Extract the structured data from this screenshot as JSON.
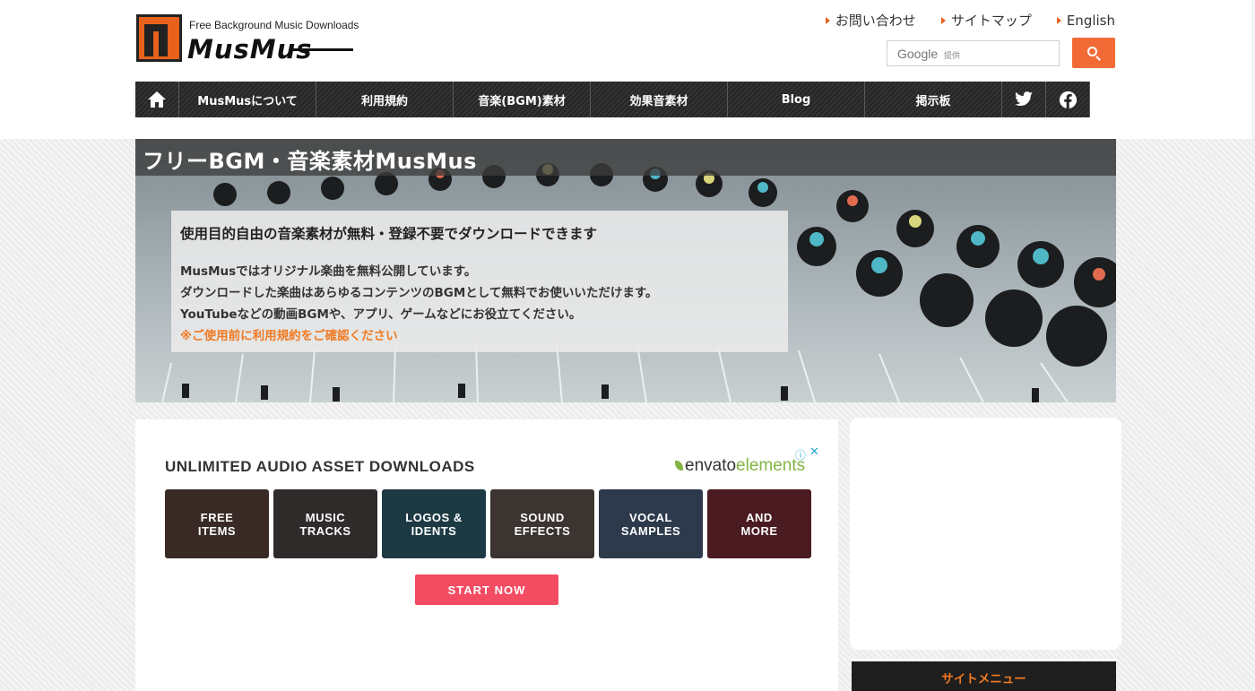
{
  "header": {
    "logo": {
      "tagline": "Free Background Music Downloads",
      "wordmark": "MusMus"
    },
    "top_links": [
      {
        "label": "お問い合わせ"
      },
      {
        "label": "サイトマップ"
      },
      {
        "label": "English"
      }
    ],
    "search": {
      "logo_text": "Google",
      "provided_label": "提供",
      "button_icon": "search-icon"
    }
  },
  "nav": {
    "home_icon": "home-icon",
    "items": [
      {
        "label": "MusMusについて"
      },
      {
        "label": "利用規約"
      },
      {
        "label": "音楽(BGM)素材"
      },
      {
        "label": "効果音素材"
      },
      {
        "label": "Blog"
      },
      {
        "label": "掲示板"
      }
    ],
    "social_icons": [
      "twitter-icon",
      "facebook-icon"
    ]
  },
  "hero": {
    "title": "フリーBGM・音楽素材MusMus",
    "intro_heading": "使用目的自由の音楽素材が無料・登録不要でダウンロードできます",
    "lines": [
      "MusMusではオリジナル楽曲を無料公開しています。",
      "ダウンロードした楽曲はあらゆるコンテンツのBGMとして無料でお使いいただけます。",
      "YouTubeなどの動画BGMや、アプリ、ゲームなどにお役立てください。"
    ],
    "warning": "※ご使用前に利用規約をご確認ください"
  },
  "ad": {
    "headline": "UNLIMITED AUDIO ASSET DOWNLOADS",
    "brand_main": "envato",
    "brand_sub": "elements",
    "tiles": [
      {
        "label": "FREE\nITEMS",
        "color": "#3a2a26"
      },
      {
        "label": "MUSIC\nTRACKS",
        "color": "#2f2b2a"
      },
      {
        "label": "LOGOS &\nIDENTS",
        "color": "#1d3a44"
      },
      {
        "label": "SOUND\nEFFECTS",
        "color": "#3c3430"
      },
      {
        "label": "VOCAL\nSAMPLES",
        "color": "#2d3a4c"
      },
      {
        "label": "AND\nMORE",
        "color": "#4a1c22"
      }
    ],
    "cta": "START NOW",
    "cta_color": "#f24b62"
  },
  "sidebar": {
    "menu_title": "サイトメニュー"
  },
  "colors": {
    "accent": "#f26b37",
    "warning": "#f07a22",
    "nav_bg": "#262626"
  }
}
